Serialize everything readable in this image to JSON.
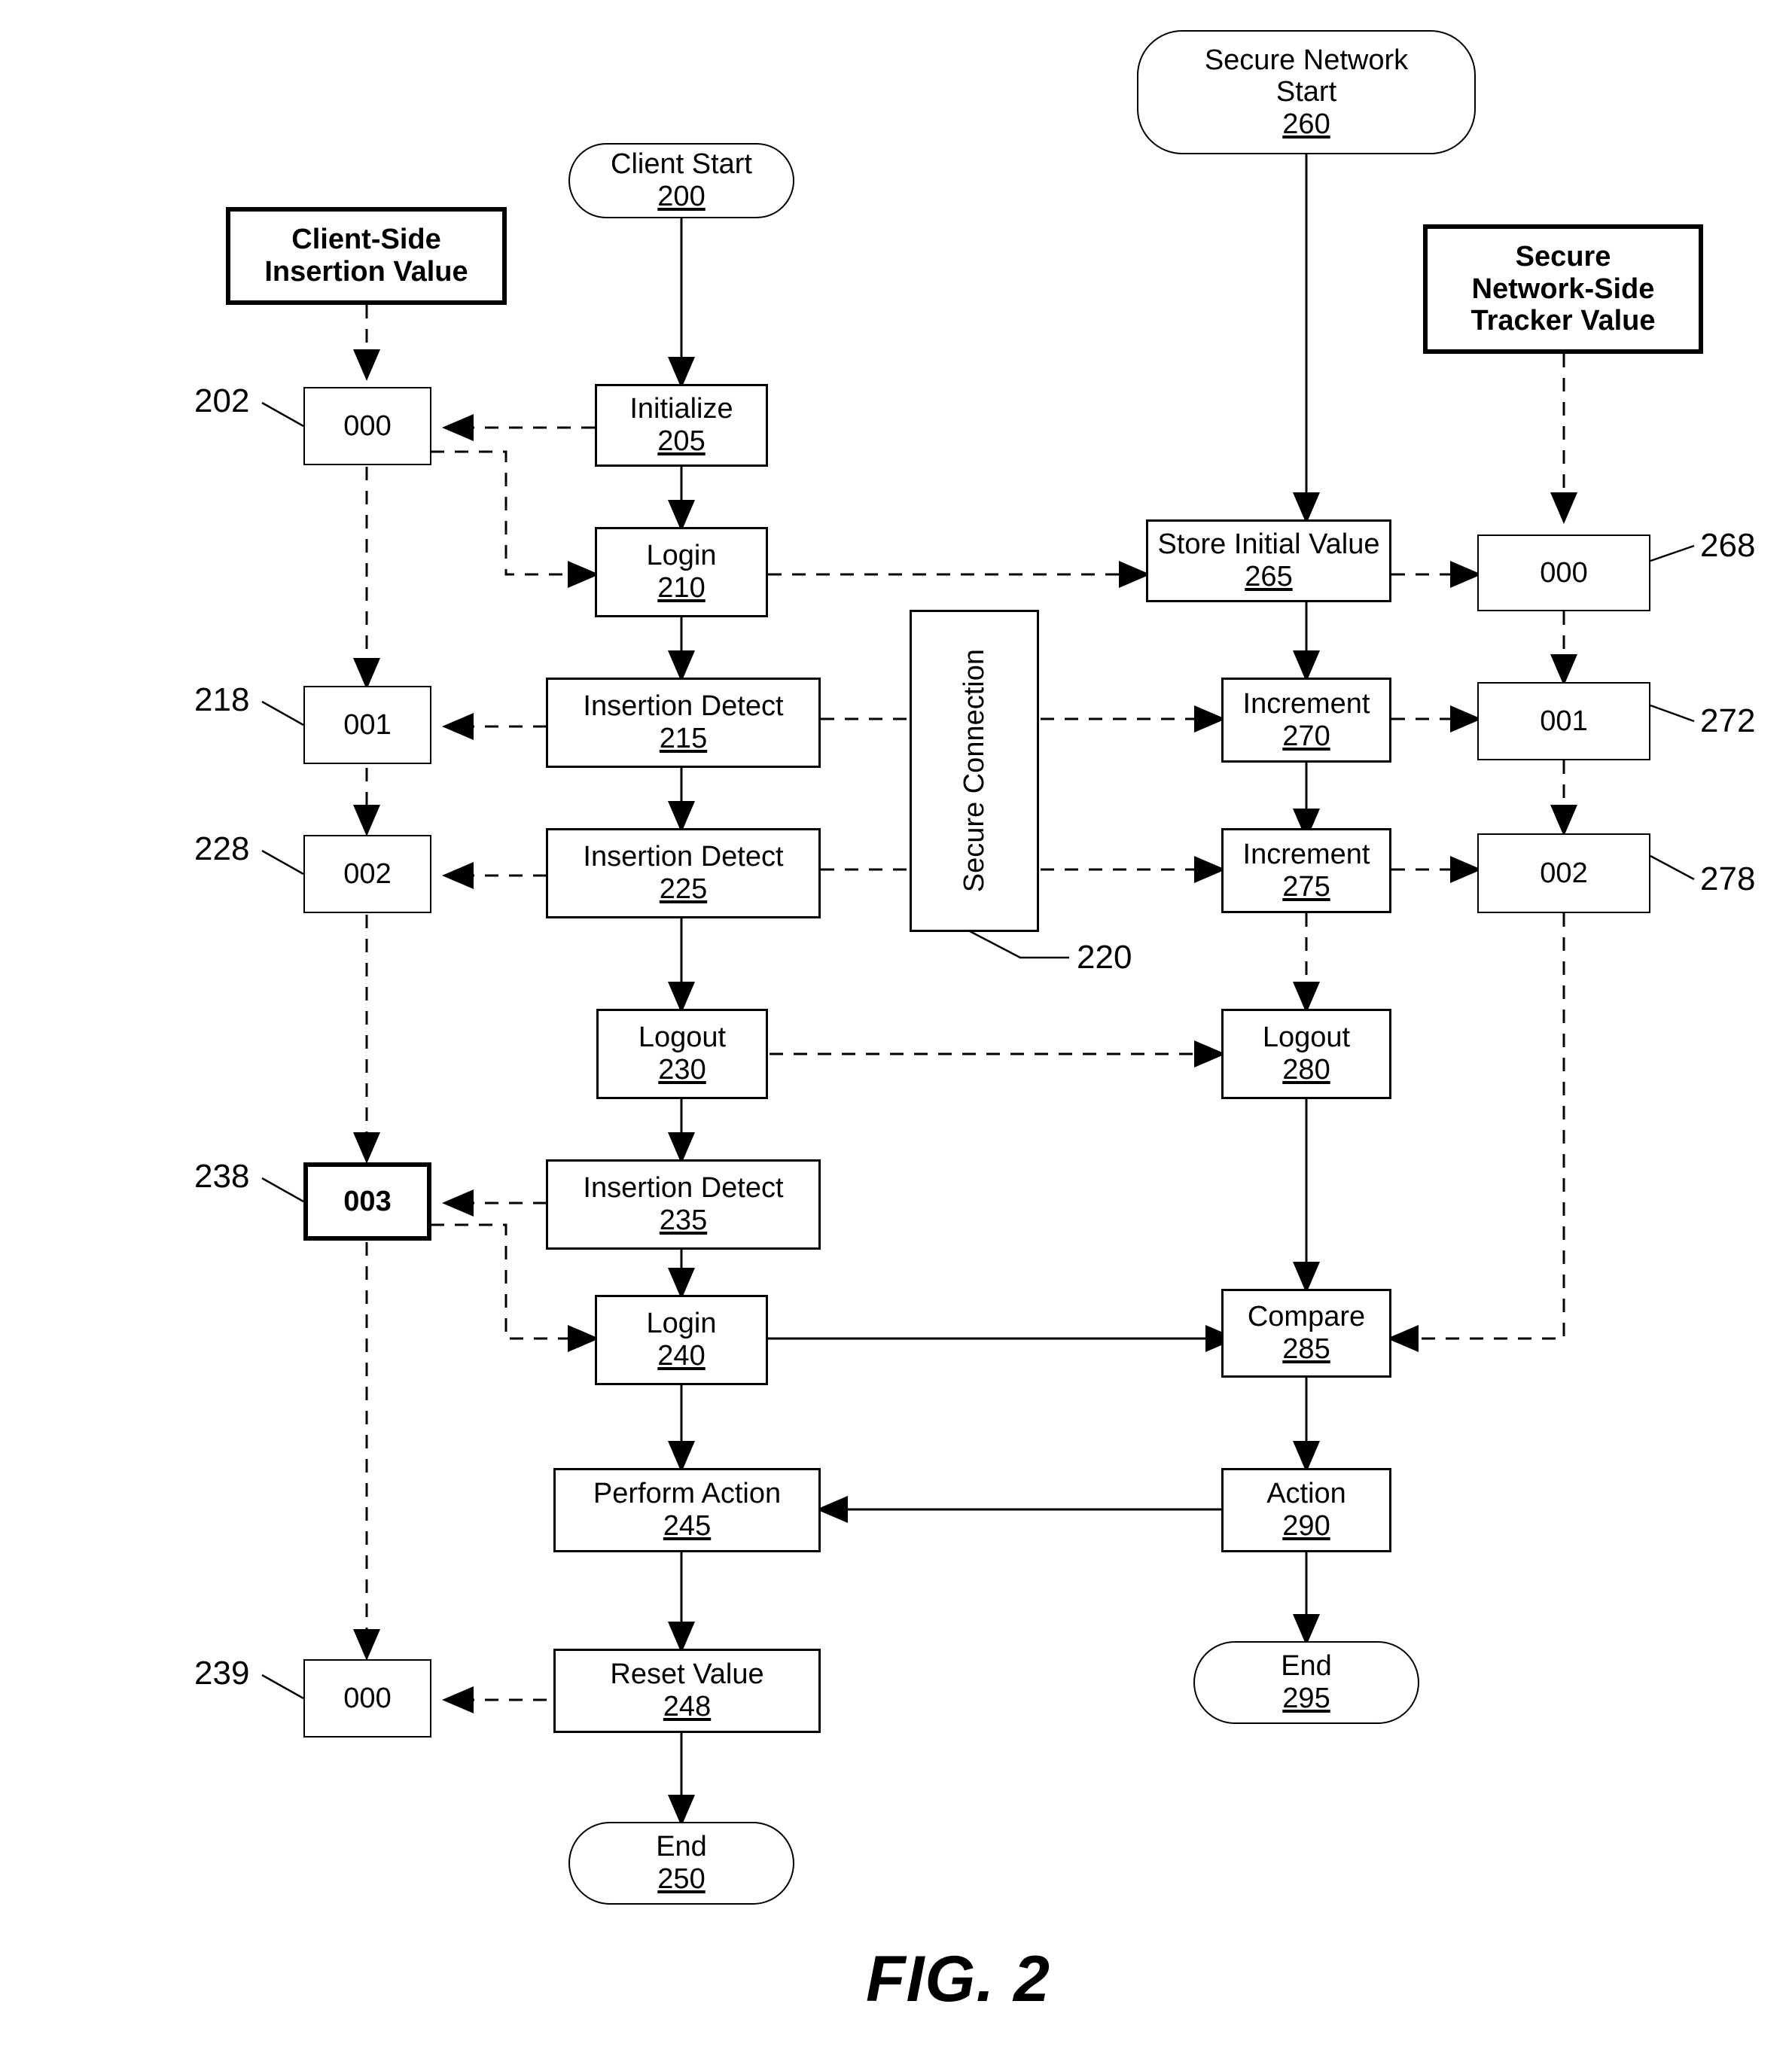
{
  "figure": {
    "caption": "FIG. 2"
  },
  "headers": {
    "client_side": "Client-Side\nInsertion Value",
    "client_side_line1": "Client-Side",
    "client_side_line2": "Insertion Value",
    "network_side_line1": "Secure",
    "network_side_line2": "Network-Side",
    "network_side_line3": "Tracker Value"
  },
  "terminals": [
    {
      "id": "client-start",
      "label": "Client Start",
      "ref": "200"
    },
    {
      "id": "secure-network-start",
      "label_line1": "Secure Network",
      "label_line2": "Start",
      "ref": "260"
    },
    {
      "id": "client-end",
      "label": "End",
      "ref": "250"
    },
    {
      "id": "network-end",
      "label": "End",
      "ref": "295"
    }
  ],
  "client_flow": [
    {
      "id": "initialize",
      "label": "Initialize",
      "ref": "205"
    },
    {
      "id": "login-210",
      "label": "Login",
      "ref": "210"
    },
    {
      "id": "insertion-detect-215",
      "label": "Insertion Detect",
      "ref": "215"
    },
    {
      "id": "insertion-detect-225",
      "label": "Insertion Detect",
      "ref": "225"
    },
    {
      "id": "logout-230",
      "label": "Logout",
      "ref": "230"
    },
    {
      "id": "insertion-detect-235",
      "label": "Insertion Detect",
      "ref": "235"
    },
    {
      "id": "login-240",
      "label": "Login",
      "ref": "240"
    },
    {
      "id": "perform-action-245",
      "label": "Perform Action",
      "ref": "245"
    },
    {
      "id": "reset-value-248",
      "label": "Reset Value",
      "ref": "248"
    }
  ],
  "network_flow": [
    {
      "id": "store-initial-value-265",
      "label": "Store Initial Value",
      "ref": "265"
    },
    {
      "id": "increment-270",
      "label": "Increment",
      "ref": "270"
    },
    {
      "id": "increment-275",
      "label": "Increment",
      "ref": "275"
    },
    {
      "id": "logout-280",
      "label": "Logout",
      "ref": "280"
    },
    {
      "id": "compare-285",
      "label": "Compare",
      "ref": "285"
    },
    {
      "id": "action-290",
      "label": "Action",
      "ref": "290"
    }
  ],
  "secure_connection": {
    "label": "Secure Connection",
    "ref": "220"
  },
  "client_values": [
    {
      "id": "client-value-202",
      "value": "000",
      "ref": "202"
    },
    {
      "id": "client-value-218",
      "value": "001",
      "ref": "218"
    },
    {
      "id": "client-value-228",
      "value": "002",
      "ref": "228"
    },
    {
      "id": "client-value-238",
      "value": "003",
      "ref": "238"
    },
    {
      "id": "client-value-239",
      "value": "000",
      "ref": "239"
    }
  ],
  "network_values": [
    {
      "id": "network-value-268",
      "value": "000",
      "ref": "268"
    },
    {
      "id": "network-value-272",
      "value": "001",
      "ref": "272"
    },
    {
      "id": "network-value-278",
      "value": "002",
      "ref": "278"
    }
  ],
  "colors": {
    "line": "#000000",
    "background": "#ffffff"
  }
}
